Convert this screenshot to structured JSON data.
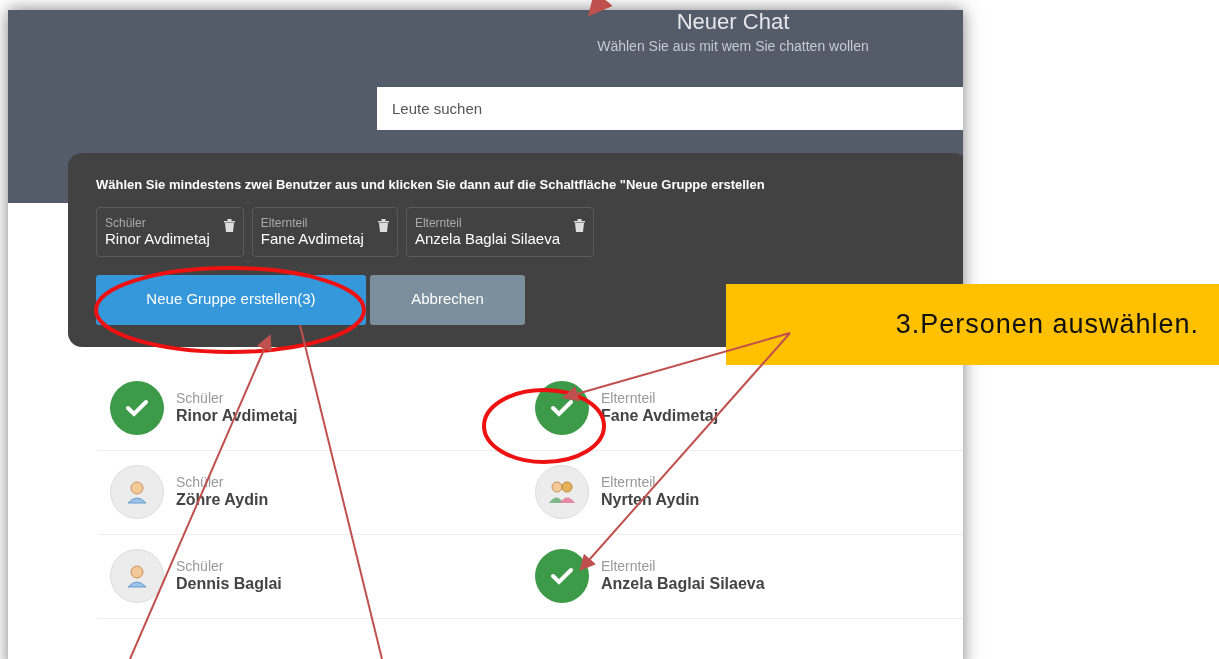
{
  "header": {
    "title": "Neuer Chat",
    "subtitle": "Wählen Sie aus mit wem Sie chatten wollen"
  },
  "search": {
    "placeholder": "Leute suchen"
  },
  "group_panel": {
    "instruction": "Wählen Sie mindestens zwei Benutzer aus und klicken Sie dann auf die Schaltfläche \"Neue Gruppe erstellen",
    "chips": [
      {
        "role": "Schüler",
        "name": "Rinor Avdimetaj"
      },
      {
        "role": "Elternteil",
        "name": "Fane Avdimetaj"
      },
      {
        "role": "Elternteil",
        "name": "Anzela Baglai Silaeva"
      }
    ],
    "buttons": [
      {
        "kind": "primary",
        "label": "Neue Gruppe erstellen(3)"
      },
      {
        "kind": "secondary",
        "label": "Abbrechen"
      }
    ]
  },
  "contacts": [
    [
      {
        "role": "Schüler",
        "name": "Rinor Avdimetaj",
        "selected": true
      },
      {
        "role": "Elternteil",
        "name": "Fane Avdimetaj",
        "selected": true
      }
    ],
    [
      {
        "role": "Schüler",
        "name": "Zöhre Aydin",
        "selected": false,
        "kind": "student"
      },
      {
        "role": "Elternteil",
        "name": "Nyrten Aydin",
        "selected": false,
        "kind": "parent"
      }
    ],
    [
      {
        "role": "Schüler",
        "name": "Dennis Baglai",
        "selected": false,
        "kind": "student"
      },
      {
        "role": "Elternteil",
        "name": "Anzela Baglai Silaeva",
        "selected": true
      }
    ]
  ],
  "callout": {
    "text": "3.Personen auswählen."
  }
}
